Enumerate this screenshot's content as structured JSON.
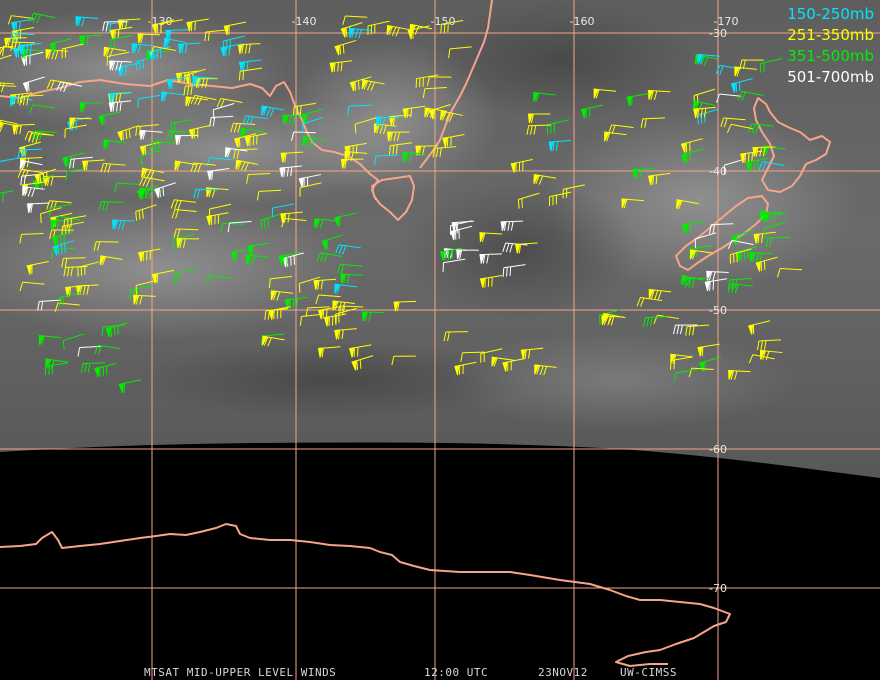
{
  "colors": {
    "grid": "#f5a58a",
    "coast": "#f5a58a",
    "imagery_top": "#707070",
    "imagery_bottom": "#444444",
    "no_data": "#000000"
  },
  "longitude_labels": [
    "-130",
    "-140",
    "-150",
    "-160",
    "-170"
  ],
  "latitude_labels": [
    "-30",
    "-40",
    "-50",
    "-60",
    "-70"
  ],
  "legend": [
    {
      "label": "150-250mb",
      "color": "#00e5ff"
    },
    {
      "label": "251-350mb",
      "color": "#ffff00"
    },
    {
      "label": "351-500mb",
      "color": "#00ee00"
    },
    {
      "label": "501-700mb",
      "color": "#ffffff"
    }
  ],
  "caption": {
    "product": "MTSAT MID-UPPER LEVEL WINDS",
    "time": "12:00 UTC",
    "date": "23NOV12",
    "source": "UW-CIMSS"
  }
}
